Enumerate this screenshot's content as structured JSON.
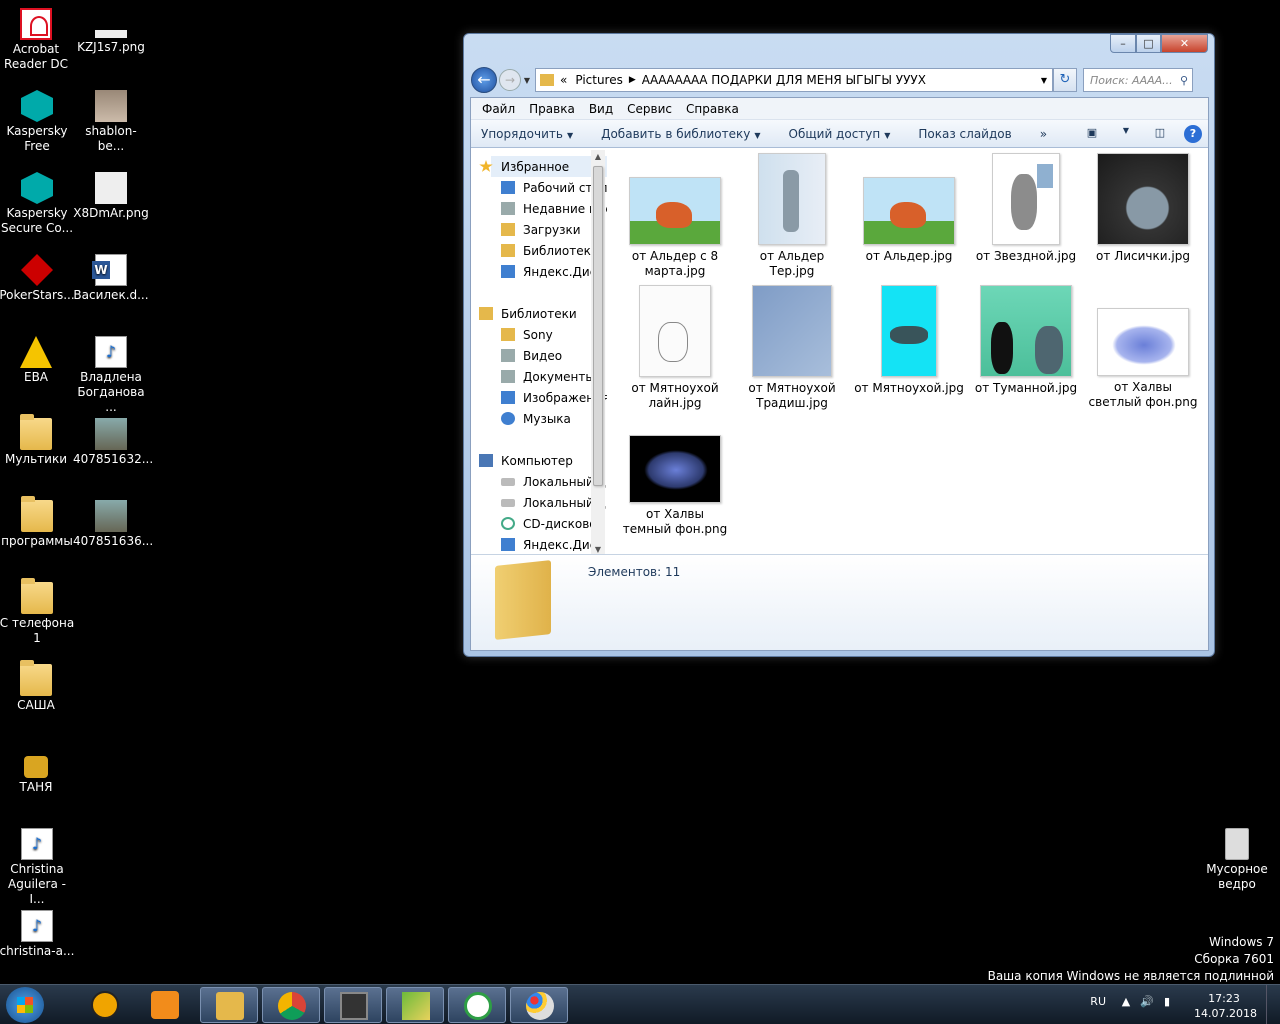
{
  "desktop": {
    "left_icons": [
      {
        "label": "Acrobat Reader DC",
        "icon": "acrobat-icon"
      },
      {
        "label": "Kaspersky Free",
        "icon": "kaspersky-icon"
      },
      {
        "label": "Kaspersky Secure Co...",
        "icon": "kaspersky-secure-icon"
      },
      {
        "label": "PokerStars...",
        "icon": "pokerstars-icon"
      },
      {
        "label": "EBA",
        "icon": "warning-icon"
      },
      {
        "label": "Мультики",
        "icon": "folder-icon"
      },
      {
        "label": "программы",
        "icon": "folder-icon"
      },
      {
        "label": "С телефона 1",
        "icon": "folder-icon"
      },
      {
        "label": "САША",
        "icon": "folder-icon"
      },
      {
        "label": "ТАНЯ",
        "icon": "lock-folder-icon"
      },
      {
        "label": "Christina Aguilera - I...",
        "icon": "mp3-icon"
      },
      {
        "label": "christina-a...",
        "icon": "mp3-icon"
      }
    ],
    "second_icons": [
      {
        "label": "KZJ1s7.png",
        "icon": "image-icon"
      },
      {
        "label": "shablon-be...",
        "icon": "image-icon"
      },
      {
        "label": "X8DmAr.png",
        "icon": "image-icon"
      },
      {
        "label": "Василек.d...",
        "icon": "word-icon"
      },
      {
        "label": "Владлена Богданова ...",
        "icon": "mp3-icon"
      },
      {
        "label": "407851632...",
        "icon": "photo-icon"
      },
      {
        "label": "407851636...",
        "icon": "photo-icon"
      }
    ],
    "recycle_bin": "Мусорное ведро",
    "watermark": [
      "Windows 7",
      "Сборка 7601",
      "Ваша копия Windows не является подлинной"
    ]
  },
  "window": {
    "address": {
      "root": "Pictures",
      "folder": "АААААААА ПОДАРКИ ДЛЯ МЕНЯ ЫГЫГЫ УУУХ"
    },
    "search_placeholder": "Поиск: АААА...",
    "menu": [
      "Файл",
      "Правка",
      "Вид",
      "Сервис",
      "Справка"
    ],
    "toolbar": {
      "organize": "Упорядочить",
      "add_library": "Добавить в библиотеку",
      "share": "Общий доступ",
      "slideshow": "Показ слайдов",
      "more": "»"
    },
    "nav": {
      "favorites": {
        "title": "Избранное",
        "items": [
          "Рабочий стол",
          "Недавние места",
          "Загрузки",
          "Библиотеки",
          "Яндекс.Диск"
        ]
      },
      "libraries": {
        "title": "Библиотеки",
        "items": [
          "Sony",
          "Видео",
          "Документы",
          "Изображения",
          "Музыка"
        ]
      },
      "computer": {
        "title": "Компьютер",
        "items": [
          "Локальный диск",
          "Локальный диск",
          "CD-дисковод",
          "Яндекс.Диск"
        ]
      }
    },
    "files": [
      {
        "name": "от Альдер с 8 марта.jpg"
      },
      {
        "name": "от Альдер Тер.jpg"
      },
      {
        "name": "от Альдер.jpg"
      },
      {
        "name": "от Звездной.jpg"
      },
      {
        "name": "от Лисички.jpg"
      },
      {
        "name": "от Мятноухой лайн.jpg"
      },
      {
        "name": "от Мятноухой Традиш.jpg"
      },
      {
        "name": "от Мятноухой.jpg"
      },
      {
        "name": "от Туманной.jpg"
      },
      {
        "name": "от Халвы светлый фон.png"
      },
      {
        "name": "от Халвы темный фон.png"
      }
    ],
    "status": "Элементов: 11"
  },
  "taskbar": {
    "lang": "RU",
    "time": "17:23",
    "date": "14.07.2018"
  }
}
